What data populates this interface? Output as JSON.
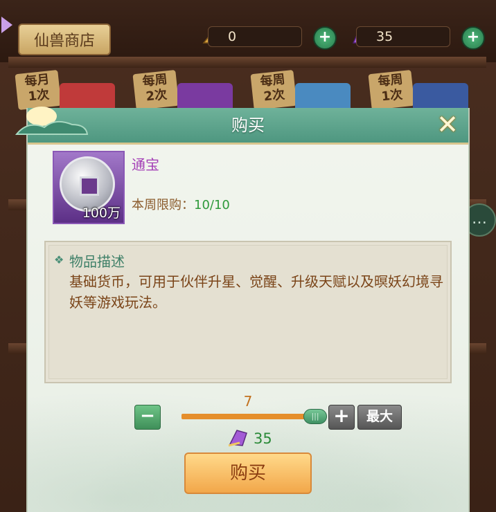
{
  "shop": {
    "title": "仙兽商店",
    "currency_1": {
      "icon": "feather-token-icon",
      "amount": "0"
    },
    "currency_2": {
      "icon": "purple-crystal-icon",
      "amount": "35"
    },
    "limits": [
      {
        "period": "每月",
        "count": "1次"
      },
      {
        "period": "每周",
        "count": "2次"
      },
      {
        "period": "每周",
        "count": "2次"
      },
      {
        "period": "每周",
        "count": "1次"
      }
    ]
  },
  "dialog": {
    "title": "购买",
    "item": {
      "name": "通宝",
      "quantity_label": "100万",
      "icon": "silver-coin-icon",
      "limit_label": "本周限购：",
      "limit_value": "10/10"
    },
    "description": {
      "title": "物品描述",
      "text": "基础货币，可用于伙伴升星、觉醒、升级天赋以及暝妖幻境寻妖等游戏玩法。"
    },
    "purchase": {
      "quantity": "7",
      "max_label": "最大",
      "price": "35",
      "buy_label": "购买"
    }
  },
  "colors": {
    "header_green": "#5ea58c",
    "price_green": "#2a8a38",
    "item_name_purple": "#a43fb6",
    "slider_orange": "#e58e2b"
  }
}
